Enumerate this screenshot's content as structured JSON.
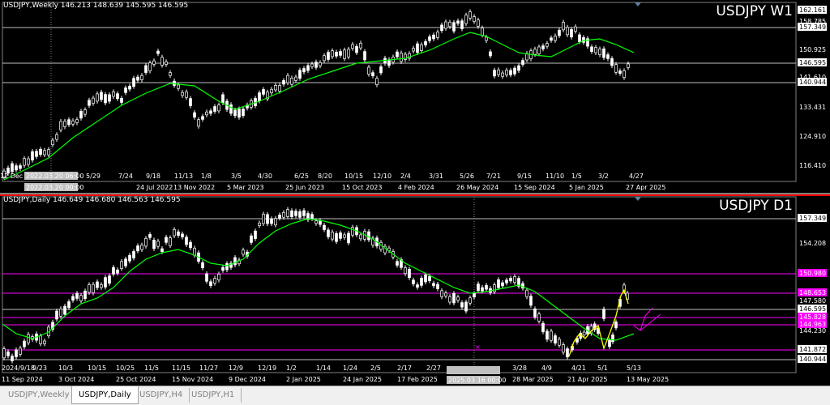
{
  "weekly": {
    "header": "USDJPY,Weekly  146.213 148.639 145.595 146.595",
    "symbol_title": "USDJPY W1",
    "price_labels": [
      "162.161",
      "158.785",
      "157.349",
      "150.925",
      "146.595",
      "141.610",
      "140.944",
      "133.431",
      "124.910",
      "116.410"
    ],
    "time_labels": [
      "12 Dec 2021",
      "5/29",
      "7/24",
      "24 Jul 2022",
      "9/18",
      "11/13",
      "13 Nov 2022",
      "1/8",
      "3/5",
      "5 Mar 2023",
      "4/30",
      "6/25",
      "25 Jun 2023",
      "8/20",
      "10/15",
      "15 Oct 2023",
      "12/10",
      "2/4",
      "4 Feb 2024",
      "3/31",
      "5/26",
      "26 May 2024",
      "7/21",
      "9/15",
      "15 Sep 2024",
      "11/10",
      "1/5",
      "5 Jan 2025",
      "3/2",
      "4/27",
      "27 Apr 2025"
    ],
    "crosshair_time": "2022.03.20 06:00",
    "crosshair_time_2": "2022.03.20 00:00"
  },
  "daily": {
    "header": "USDJPY,Daily  146.649 146.680 146.563 146.595",
    "symbol_title": "USDJPY D1",
    "price_labels": [
      "157.349",
      "154.208",
      "150.980",
      "148.653",
      "147.580",
      "146.595",
      "145.828",
      "144.963",
      "144.230",
      "141.872",
      "140.944"
    ],
    "time_labels": [
      "2024/9/18",
      "9/23",
      "11 Sep 2024",
      "10/3",
      "3 Oct 2024",
      "10/15",
      "10/25",
      "25 Oct 2024",
      "11/5",
      "11/15",
      "15 Nov 2024",
      "11/27",
      "12/9",
      "9 Dec 2024",
      "12/19",
      "1/2",
      "2 Jan 2025",
      "1/14",
      "1/24",
      "24 Jan 2025",
      "2/5",
      "2/17",
      "17 Feb 2025",
      "2/27",
      "3/28",
      "28 Mar 2025",
      "4/9",
      "4/21",
      "21 Apr 2025",
      "5/1",
      "5/13",
      "13 May 2025"
    ],
    "crosshair_time": "2025.03.16 00:00"
  },
  "tabs": [
    {
      "label": "USDJPY,Weekly",
      "active": false
    },
    {
      "label": "USDJPY,Daily",
      "active": true
    },
    {
      "label": "USDJPY,H4",
      "active": false
    },
    {
      "label": "USDJPY,H1",
      "active": false
    }
  ],
  "colors": {
    "background": "#000000",
    "candle_up": "#ffffff",
    "candle_down": "#ffffff",
    "ma_line": "#00ff00",
    "hline": "#ffffff",
    "magenta": "#ff00ff",
    "yellow": "#ffff00"
  }
}
